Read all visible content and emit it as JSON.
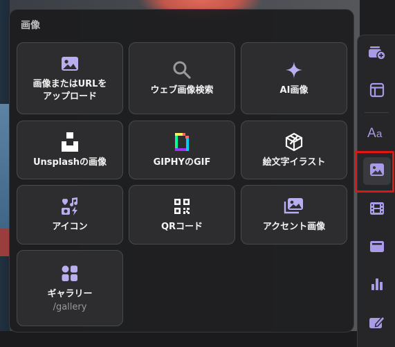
{
  "panel": {
    "title": "画像",
    "cards": [
      {
        "label": "画像またはURLを\nアップロード",
        "icon": "image-upload-icon"
      },
      {
        "label": "ウェブ画像検索",
        "icon": "search-icon"
      },
      {
        "label": "AI画像",
        "icon": "sparkle-icon"
      },
      {
        "label": "Unsplashの画像",
        "icon": "unsplash-logo-icon"
      },
      {
        "label": "GIPHYのGIF",
        "icon": "giphy-logo-icon"
      },
      {
        "label": "絵文字イラスト",
        "icon": "emoji-illustration-icon"
      },
      {
        "label": "アイコン",
        "icon": "icons-icon"
      },
      {
        "label": "QRコード",
        "icon": "qr-code-icon"
      },
      {
        "label": "アクセント画像",
        "icon": "accent-image-icon"
      },
      {
        "label": "ギャラリー",
        "sub": "/gallery",
        "icon": "gallery-icon"
      }
    ]
  },
  "rail": {
    "items": [
      {
        "name": "add-card",
        "icon": "add-card-icon"
      },
      {
        "name": "layout",
        "icon": "layout-icon"
      },
      {
        "name": "text",
        "icon": "text-style-icon"
      },
      {
        "name": "image",
        "icon": "image-icon",
        "active": true
      },
      {
        "name": "video",
        "icon": "film-icon"
      },
      {
        "name": "embed",
        "icon": "embed-icon"
      },
      {
        "name": "chart",
        "icon": "chart-icon"
      },
      {
        "name": "edit",
        "icon": "edit-icon"
      }
    ]
  },
  "colors": {
    "accent": "#a99be8",
    "highlight": "#e01515",
    "panel": "#1c1c1e"
  }
}
